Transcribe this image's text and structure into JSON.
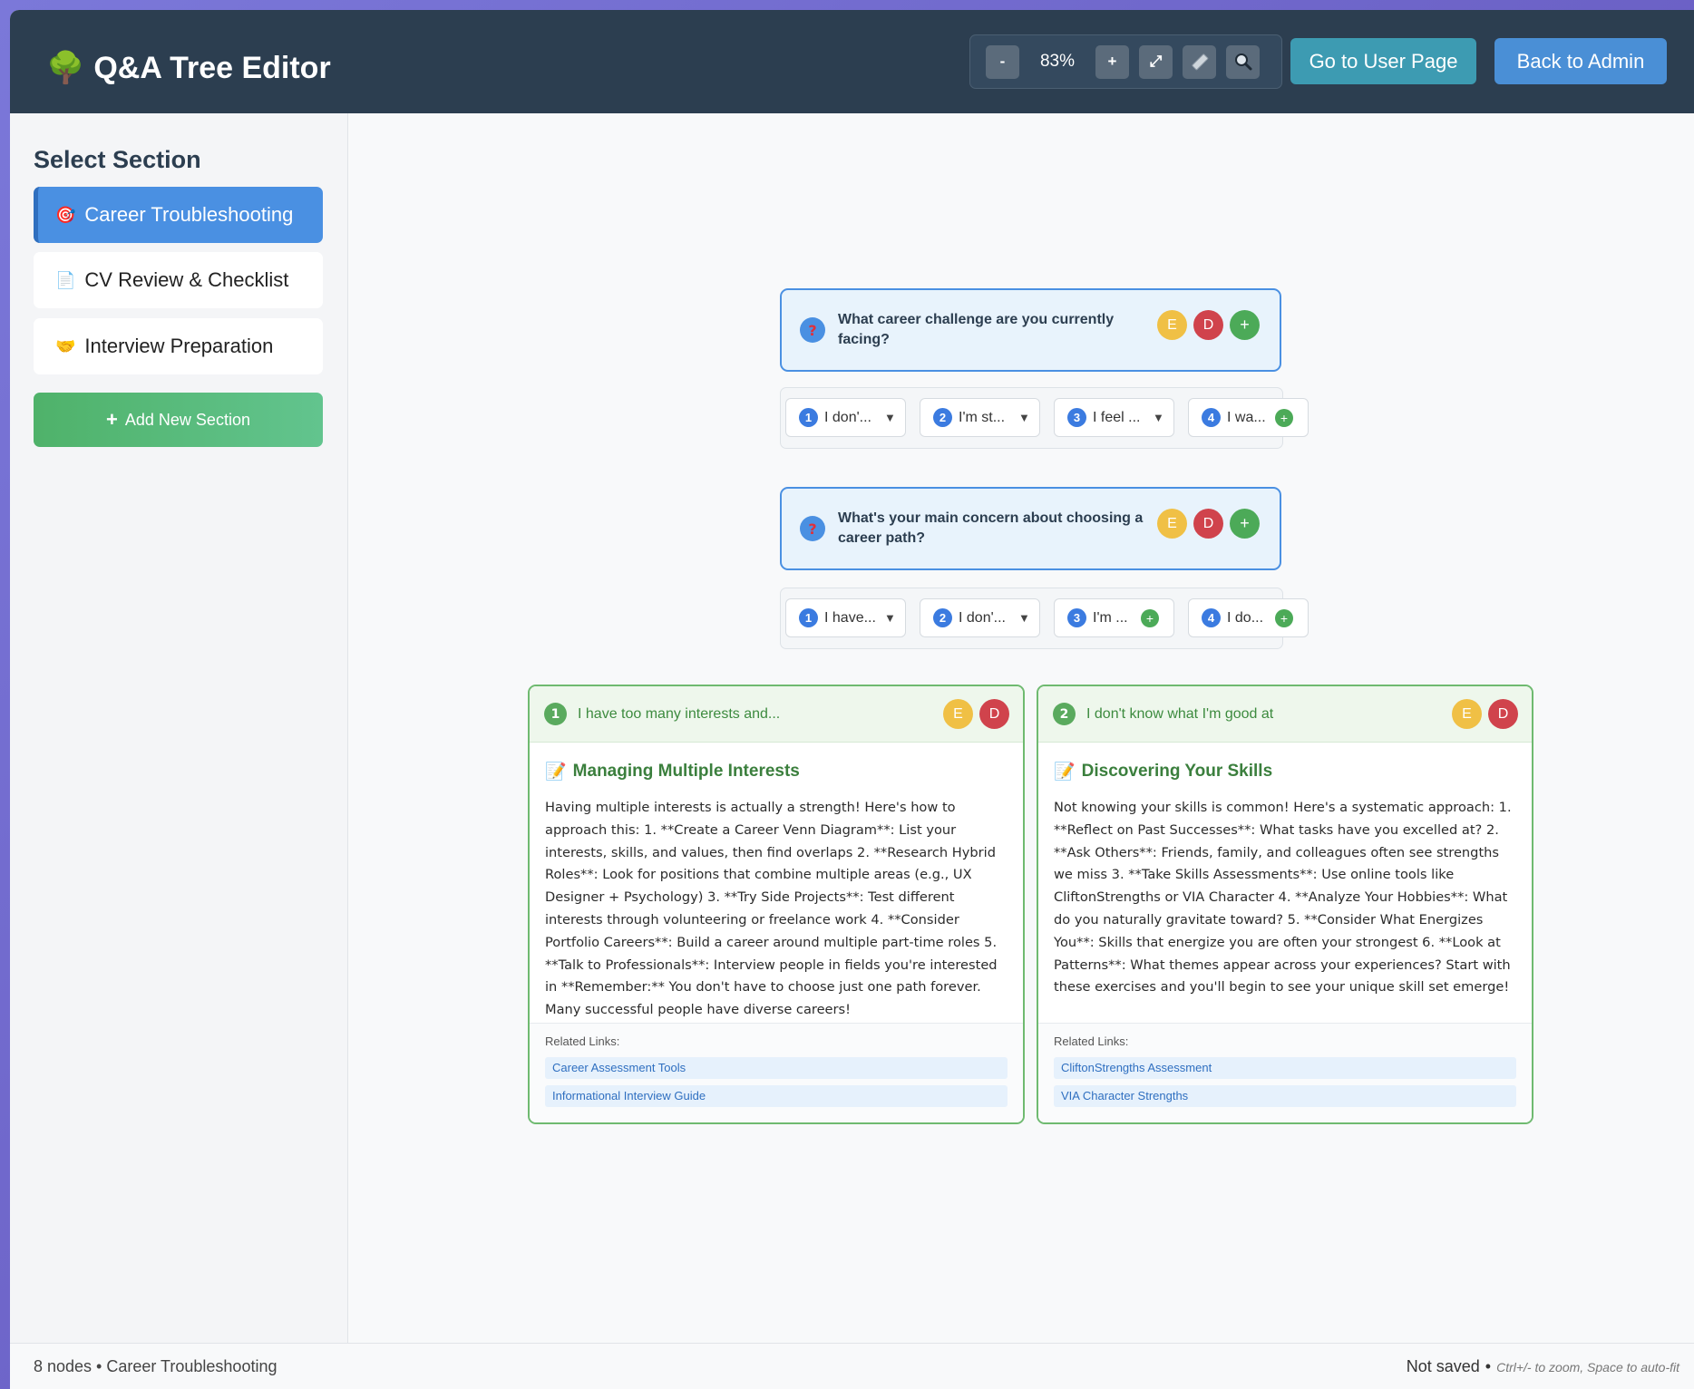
{
  "header": {
    "title_icon": "🌳",
    "title": "Q&A Tree Editor",
    "zoom_minus": "-",
    "zoom_level": "83%",
    "zoom_plus": "+",
    "fit_icon": "expand-icon",
    "ruler_icon": "ruler-icon",
    "search_icon": "magnifier-icon",
    "user_page_button": "Go to User Page",
    "back_admin_button": "Back to Admin"
  },
  "sidebar": {
    "title": "Select Section",
    "sections": [
      {
        "icon": "🎯",
        "label": "Career Troubleshooting",
        "active": true
      },
      {
        "icon": "📄",
        "label": "CV Review & Checklist",
        "active": false
      },
      {
        "icon": "🤝",
        "label": "Interview Preparation",
        "active": false
      }
    ],
    "add_icon": "+",
    "add_label": "Add New Section"
  },
  "tree": {
    "questions": [
      {
        "text": "What career challenge are you currently facing?",
        "edit": "E",
        "delete": "D",
        "add": "+",
        "answers": [
          {
            "num": "1",
            "label": "I don'...",
            "action": "▼"
          },
          {
            "num": "2",
            "label": "I'm st...",
            "action": "▼"
          },
          {
            "num": "3",
            "label": "I feel ...",
            "action": "▼"
          },
          {
            "num": "4",
            "label": "I wa...",
            "action": "+"
          }
        ]
      },
      {
        "text": "What's your main concern about choosing a career path?",
        "edit": "E",
        "delete": "D",
        "add": "+",
        "answers": [
          {
            "num": "1",
            "label": "I have...",
            "action": "▼"
          },
          {
            "num": "2",
            "label": "I don'...",
            "action": "▼"
          },
          {
            "num": "3",
            "label": "I'm ...",
            "action": "+"
          },
          {
            "num": "4",
            "label": "I do...",
            "action": "+"
          }
        ]
      }
    ],
    "cards": [
      {
        "num": "1",
        "answer": "I have too many interests and...",
        "edit": "E",
        "delete": "D",
        "title_icon": "📝",
        "title": "Managing Multiple Interests",
        "body": "Having multiple interests is actually a strength! Here's how to approach this: 1. **Create a Career Venn Diagram**: List your interests, skills, and values, then find overlaps 2. **Research Hybrid Roles**: Look for positions that combine multiple areas (e.g., UX Designer + Psychology) 3. **Try Side Projects**: Test different interests through volunteering or freelance work 4. **Consider Portfolio Careers**: Build a career around multiple part-time roles 5. **Talk to Professionals**: Interview people in fields you're interested in **Remember:** You don't have to choose just one path forever. Many successful people have diverse careers!",
        "links_label": "Related Links:",
        "links": [
          "Career Assessment Tools",
          "Informational Interview Guide"
        ]
      },
      {
        "num": "2",
        "answer": "I don't know what I'm good at",
        "edit": "E",
        "delete": "D",
        "title_icon": "📝",
        "title": "Discovering Your Skills",
        "body": "Not knowing your skills is common! Here's a systematic approach: 1. **Reflect on Past Successes**: What tasks have you excelled at? 2. **Ask Others**: Friends, family, and colleagues often see strengths we miss 3. **Take Skills Assessments**: Use online tools like CliftonStrengths or VIA Character 4. **Analyze Your Hobbies**: What do you naturally gravitate toward? 5. **Consider What Energizes You**: Skills that energize you are often your strongest 6. **Look at Patterns**: What themes appear across your experiences? Start with these exercises and you'll begin to see your unique skill set emerge!",
        "links_label": "Related Links:",
        "links": [
          "CliftonStrengths Assessment",
          "VIA Character Strengths"
        ]
      }
    ]
  },
  "footer": {
    "status": "8 nodes • Career Troubleshooting",
    "save_status": "Not saved",
    "separator": "•",
    "hint": "Ctrl+/- to zoom, Space to auto-fit"
  },
  "colors": {
    "header_bg": "#2c3e50",
    "accent": "#4a90e2",
    "success": "#4caa58",
    "edit": "#f0c045",
    "delete": "#d0434c"
  }
}
